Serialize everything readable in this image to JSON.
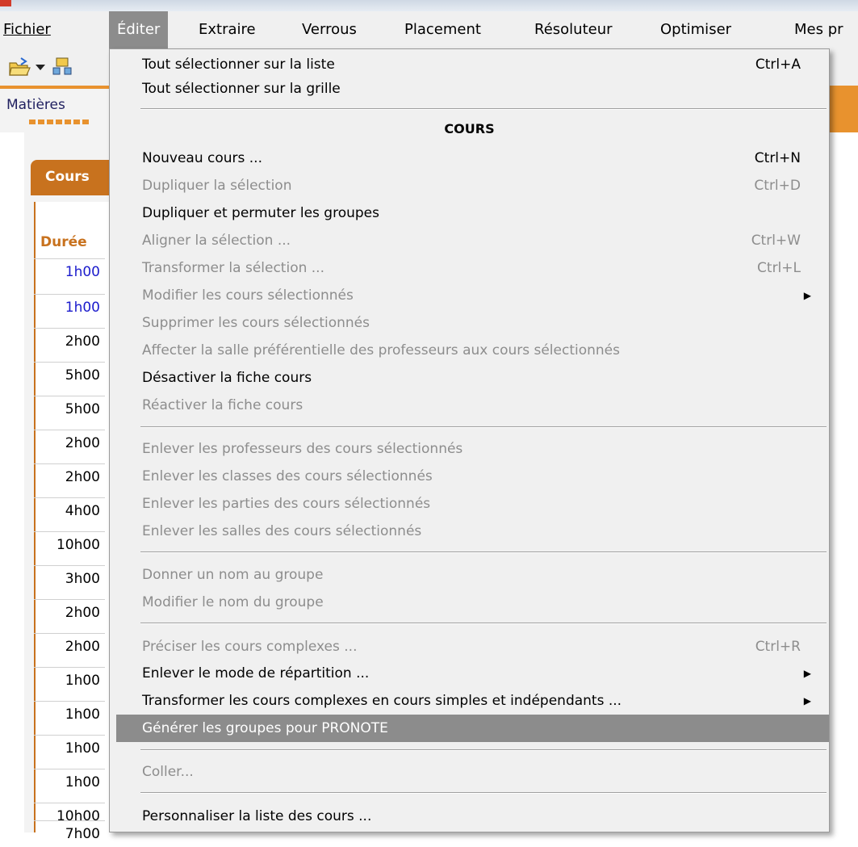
{
  "menubar": {
    "items": [
      {
        "label": "Fichier",
        "x": 0
      },
      {
        "label": "Éditer",
        "x": 1
      },
      {
        "label": "Extraire",
        "x": 2
      },
      {
        "label": "Verrous",
        "x": 3
      },
      {
        "label": "Placement",
        "x": 4
      },
      {
        "label": "Résoluteur",
        "x": 5
      },
      {
        "label": "Optimiser",
        "x": 6
      },
      {
        "label": "Mes pr",
        "x": 7
      }
    ]
  },
  "tabs": {
    "matieres": "Matières"
  },
  "panel": {
    "cours_tab": "Cours",
    "column_header": "Durée",
    "durations": [
      "1h00",
      "1h00",
      "2h00",
      "5h00",
      "5h00",
      "2h00",
      "2h00",
      "4h00",
      "10h00",
      "3h00",
      "2h00",
      "2h00",
      "1h00",
      "1h00",
      "1h00",
      "1h00",
      "10h00",
      "7h00"
    ]
  },
  "menu": {
    "select_list": {
      "label": "Tout sélectionner sur la liste",
      "shortcut": "Ctrl+A"
    },
    "select_grid": {
      "label": "Tout sélectionner sur la grille"
    },
    "section_cours": "COURS",
    "new_course": {
      "label": "Nouveau cours ...",
      "shortcut": "Ctrl+N"
    },
    "duplicate": {
      "label": "Dupliquer la sélection",
      "shortcut": "Ctrl+D"
    },
    "duplicate_permute": {
      "label": "Dupliquer et permuter les groupes"
    },
    "align": {
      "label": "Aligner la sélection ...",
      "shortcut": "Ctrl+W"
    },
    "transform": {
      "label": "Transformer la sélection ...",
      "shortcut": "Ctrl+L"
    },
    "modify": {
      "label": "Modifier les cours sélectionnés"
    },
    "delete": {
      "label": "Supprimer les cours sélectionnés"
    },
    "assign_room": {
      "label": "Affecter la salle préférentielle des professeurs aux cours sélectionnés"
    },
    "deactivate": {
      "label": "Désactiver la fiche cours"
    },
    "reactivate": {
      "label": "Réactiver la fiche cours"
    },
    "remove_teachers": {
      "label": "Enlever les professeurs des cours sélectionnés"
    },
    "remove_classes": {
      "label": "Enlever les classes des cours sélectionnés"
    },
    "remove_parts": {
      "label": "Enlever les parties des cours sélectionnés"
    },
    "remove_rooms": {
      "label": "Enlever les salles des cours sélectionnés"
    },
    "name_group": {
      "label": "Donner un nom au groupe"
    },
    "rename_group": {
      "label": "Modifier le nom du groupe"
    },
    "complex": {
      "label": "Préciser les cours complexes ...",
      "shortcut": "Ctrl+R"
    },
    "remove_mode": {
      "label": "Enlever le mode de répartition ..."
    },
    "transform_complex": {
      "label": "Transformer les cours complexes en cours simples et indépendants ..."
    },
    "generate": {
      "label": "Générer les groupes pour PRONOTE"
    },
    "paste": {
      "label": "Coller..."
    },
    "customize": {
      "label": "Personnaliser la liste des cours ..."
    }
  },
  "colors": {
    "accent_orange": "#e8922e",
    "tab_orange": "#c8721e",
    "menu_bg": "#f0f0f0",
    "highlight": "#8c8c8c",
    "disabled_text": "#8d8d8d",
    "link_blue": "#1b1bcc"
  },
  "icons": [
    "open-folder-icon",
    "dropdown-arrow-icon",
    "network-icon",
    "submenu-arrow-icon"
  ]
}
